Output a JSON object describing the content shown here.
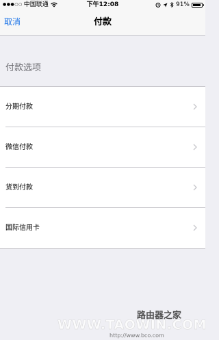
{
  "status_bar": {
    "signal": "●●●○○",
    "carrier": "中国联通",
    "time": "下午12:08",
    "battery_text": "91%",
    "battery_level": 0.91
  },
  "nav": {
    "cancel_label": "取消",
    "title": "付款"
  },
  "section": {
    "header": "付款选项"
  },
  "options": [
    {
      "label": "分期付款"
    },
    {
      "label": "微信付款"
    },
    {
      "label": "货到付款"
    },
    {
      "label": "国际信用卡"
    }
  ],
  "watermark": {
    "line1": "WWW.TAOWIN.COM",
    "line2": "路由器之家",
    "line3": "http://www.bco.com"
  }
}
